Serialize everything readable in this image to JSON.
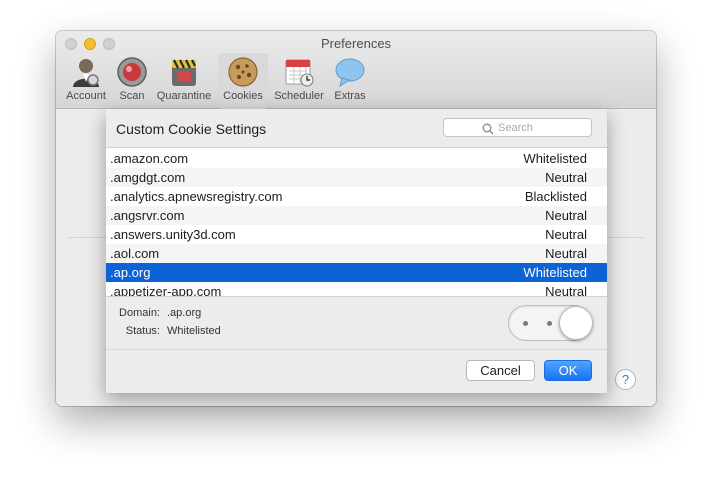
{
  "window": {
    "title": "Preferences"
  },
  "toolbar": {
    "items": [
      {
        "label": "Account",
        "icon": "account-icon"
      },
      {
        "label": "Scan",
        "icon": "scan-icon"
      },
      {
        "label": "Quarantine",
        "icon": "quarantine-icon"
      },
      {
        "label": "Cookies",
        "icon": "cookies-icon",
        "selected": true
      },
      {
        "label": "Scheduler",
        "icon": "scheduler-icon"
      },
      {
        "label": "Extras",
        "icon": "extras-icon"
      }
    ]
  },
  "sheet": {
    "title": "Custom Cookie Settings",
    "search_placeholder": "Search",
    "rows": [
      {
        "domain": ".amazon.com",
        "status": "Whitelisted"
      },
      {
        "domain": ".amgdgt.com",
        "status": "Neutral"
      },
      {
        "domain": ".analytics.apnewsregistry.com",
        "status": "Blacklisted"
      },
      {
        "domain": ".angsrvr.com",
        "status": "Neutral"
      },
      {
        "domain": ".answers.unity3d.com",
        "status": "Neutral"
      },
      {
        "domain": ".aol.com",
        "status": "Neutral"
      },
      {
        "domain": ".ap.org",
        "status": "Whitelisted",
        "selected": true
      },
      {
        "domain": ".appetizer-app.com",
        "status": "Neutral"
      }
    ],
    "detail": {
      "domain_label": "Domain:",
      "domain_value": ".ap.org",
      "status_label": "Status:",
      "status_value": "Whitelisted"
    },
    "cancel_label": "Cancel",
    "ok_label": "OK"
  },
  "help_label": "?",
  "colors": {
    "selection": "#0b63d6",
    "accent": "#1a73f0"
  }
}
